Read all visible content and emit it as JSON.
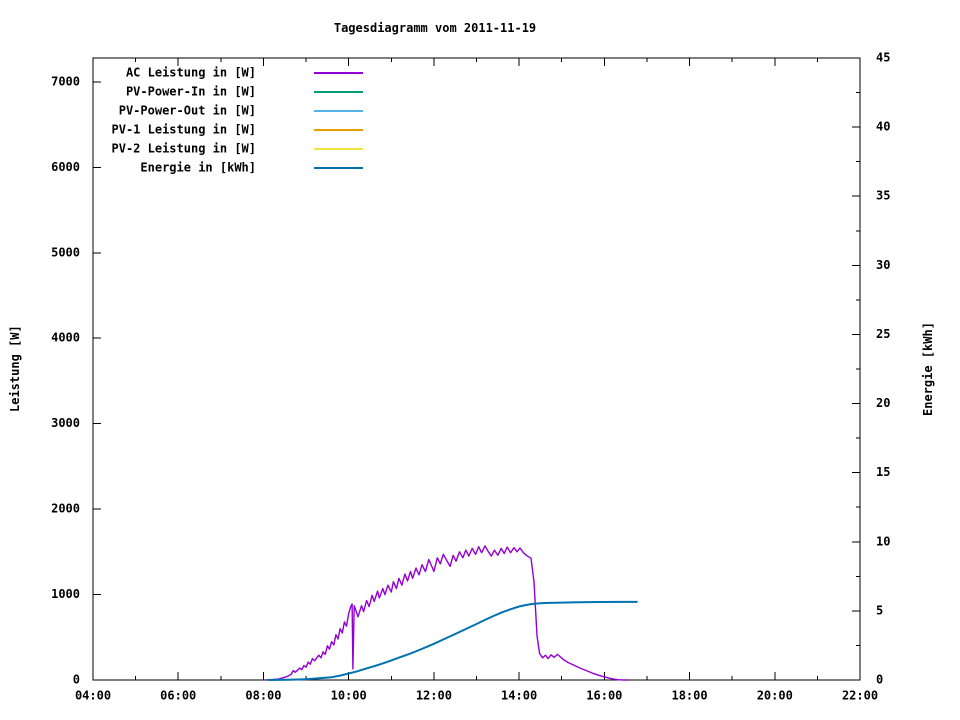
{
  "chart_data": {
    "type": "line",
    "title": "Tagesdiagramm vom 2011-11-19",
    "x_axis": {
      "unit": "time of day",
      "range": [
        4,
        22
      ],
      "ticks_major": [
        4,
        6,
        8,
        10,
        12,
        14,
        16,
        18,
        20,
        22
      ],
      "tick_labels": [
        "04:00",
        "06:00",
        "08:00",
        "10:00",
        "12:00",
        "14:00",
        "16:00",
        "18:00",
        "20:00",
        "22:00"
      ],
      "ticks_minor": [
        5,
        7,
        9,
        11,
        13,
        15,
        17,
        19,
        21
      ]
    },
    "y1_axis": {
      "label": "Leistung [W]",
      "range": [
        0,
        7280
      ],
      "ticks": [
        0,
        1000,
        2000,
        3000,
        4000,
        5000,
        6000,
        7000
      ],
      "tick_labels": [
        "0",
        "1000",
        "2000",
        "3000",
        "4000",
        "5000",
        "6000",
        "7000"
      ]
    },
    "y2_axis": {
      "label": "Energie [kWh]",
      "range": [
        0,
        45
      ],
      "ticks": [
        0,
        5,
        10,
        15,
        20,
        25,
        30,
        35,
        40,
        45
      ],
      "tick_labels": [
        "0",
        "5",
        "10",
        "15",
        "20",
        "25",
        "30",
        "35",
        "40",
        "45"
      ],
      "ticks_minor": [
        2.5,
        7.5,
        12.5,
        17.5,
        22.5,
        27.5,
        32.5,
        37.5,
        42.5
      ]
    },
    "legend_position": "top-left-inside",
    "grid": false,
    "series": [
      {
        "name": "AC Leistung in [W]",
        "color": "#9400D3",
        "axis": "y1",
        "unit": "W",
        "points": [
          [
            8.05,
            0
          ],
          [
            8.2,
            5
          ],
          [
            8.35,
            10
          ],
          [
            8.45,
            25
          ],
          [
            8.55,
            40
          ],
          [
            8.65,
            65
          ],
          [
            8.7,
            110
          ],
          [
            8.75,
            90
          ],
          [
            8.85,
            140
          ],
          [
            8.9,
            120
          ],
          [
            8.95,
            170
          ],
          [
            9.0,
            150
          ],
          [
            9.05,
            210
          ],
          [
            9.1,
            185
          ],
          [
            9.15,
            250
          ],
          [
            9.2,
            225
          ],
          [
            9.3,
            290
          ],
          [
            9.35,
            260
          ],
          [
            9.4,
            330
          ],
          [
            9.45,
            300
          ],
          [
            9.5,
            400
          ],
          [
            9.55,
            360
          ],
          [
            9.6,
            450
          ],
          [
            9.65,
            410
          ],
          [
            9.7,
            530
          ],
          [
            9.75,
            480
          ],
          [
            9.8,
            600
          ],
          [
            9.85,
            550
          ],
          [
            9.9,
            680
          ],
          [
            9.95,
            630
          ],
          [
            10.0,
            780
          ],
          [
            10.05,
            860
          ],
          [
            10.08,
            890
          ],
          [
            10.1,
            130
          ],
          [
            10.13,
            870
          ],
          [
            10.18,
            800
          ],
          [
            10.22,
            740
          ],
          [
            10.3,
            870
          ],
          [
            10.35,
            800
          ],
          [
            10.42,
            930
          ],
          [
            10.48,
            860
          ],
          [
            10.55,
            990
          ],
          [
            10.6,
            920
          ],
          [
            10.68,
            1040
          ],
          [
            10.72,
            960
          ],
          [
            10.8,
            1070
          ],
          [
            10.85,
            1000
          ],
          [
            10.92,
            1110
          ],
          [
            11.0,
            1030
          ],
          [
            11.05,
            1150
          ],
          [
            11.12,
            1070
          ],
          [
            11.18,
            1190
          ],
          [
            11.25,
            1110
          ],
          [
            11.32,
            1240
          ],
          [
            11.38,
            1160
          ],
          [
            11.45,
            1270
          ],
          [
            11.5,
            1190
          ],
          [
            11.58,
            1310
          ],
          [
            11.65,
            1230
          ],
          [
            11.72,
            1350
          ],
          [
            11.8,
            1270
          ],
          [
            11.88,
            1410
          ],
          [
            11.95,
            1330
          ],
          [
            12.0,
            1270
          ],
          [
            12.08,
            1430
          ],
          [
            12.15,
            1360
          ],
          [
            12.22,
            1470
          ],
          [
            12.3,
            1400
          ],
          [
            12.38,
            1330
          ],
          [
            12.45,
            1460
          ],
          [
            12.52,
            1390
          ],
          [
            12.6,
            1500
          ],
          [
            12.68,
            1430
          ],
          [
            12.75,
            1520
          ],
          [
            12.82,
            1450
          ],
          [
            12.9,
            1540
          ],
          [
            12.98,
            1470
          ],
          [
            13.05,
            1560
          ],
          [
            13.12,
            1490
          ],
          [
            13.2,
            1570
          ],
          [
            13.28,
            1500
          ],
          [
            13.35,
            1450
          ],
          [
            13.42,
            1520
          ],
          [
            13.5,
            1460
          ],
          [
            13.58,
            1540
          ],
          [
            13.65,
            1480
          ],
          [
            13.72,
            1555
          ],
          [
            13.8,
            1490
          ],
          [
            13.88,
            1550
          ],
          [
            13.95,
            1500
          ],
          [
            14.02,
            1545
          ],
          [
            14.1,
            1490
          ],
          [
            14.18,
            1455
          ],
          [
            14.28,
            1425
          ],
          [
            14.35,
            1150
          ],
          [
            14.42,
            520
          ],
          [
            14.48,
            310
          ],
          [
            14.55,
            260
          ],
          [
            14.62,
            290
          ],
          [
            14.68,
            250
          ],
          [
            14.75,
            295
          ],
          [
            14.82,
            265
          ],
          [
            14.9,
            300
          ],
          [
            14.98,
            265
          ],
          [
            15.05,
            235
          ],
          [
            15.15,
            205
          ],
          [
            15.3,
            170
          ],
          [
            15.45,
            135
          ],
          [
            15.6,
            105
          ],
          [
            15.75,
            75
          ],
          [
            15.9,
            50
          ],
          [
            16.05,
            30
          ],
          [
            16.2,
            12
          ],
          [
            16.32,
            3
          ],
          [
            16.45,
            0
          ],
          [
            16.55,
            0
          ]
        ]
      },
      {
        "name": "PV-Power-In in [W]",
        "color": "#009E73",
        "axis": "y1",
        "unit": "W",
        "points": []
      },
      {
        "name": "PV-Power-Out in [W]",
        "color": "#56B4E9",
        "axis": "y1",
        "unit": "W",
        "points": []
      },
      {
        "name": "PV-1 Leistung in [W]",
        "color": "#E69F00",
        "axis": "y1",
        "unit": "W",
        "points": []
      },
      {
        "name": "PV-2 Leistung in [W]",
        "color": "#F0E442",
        "axis": "y1",
        "unit": "W",
        "points": []
      },
      {
        "name": "Energie in [kWh]",
        "color": "#0072B2",
        "axis": "y2",
        "unit": "kWh",
        "points": [
          [
            8.1,
            0
          ],
          [
            8.6,
            0.02
          ],
          [
            9.0,
            0.06
          ],
          [
            9.3,
            0.12
          ],
          [
            9.6,
            0.2
          ],
          [
            9.8,
            0.32
          ],
          [
            10.0,
            0.47
          ],
          [
            10.2,
            0.63
          ],
          [
            10.4,
            0.82
          ],
          [
            10.6,
            1.0
          ],
          [
            10.8,
            1.2
          ],
          [
            11.0,
            1.42
          ],
          [
            11.2,
            1.64
          ],
          [
            11.4,
            1.86
          ],
          [
            11.6,
            2.1
          ],
          [
            11.8,
            2.36
          ],
          [
            12.0,
            2.62
          ],
          [
            12.2,
            2.9
          ],
          [
            12.4,
            3.18
          ],
          [
            12.6,
            3.47
          ],
          [
            12.8,
            3.76
          ],
          [
            13.0,
            4.05
          ],
          [
            13.2,
            4.35
          ],
          [
            13.4,
            4.63
          ],
          [
            13.6,
            4.9
          ],
          [
            13.8,
            5.12
          ],
          [
            14.0,
            5.32
          ],
          [
            14.15,
            5.42
          ],
          [
            14.3,
            5.5
          ],
          [
            14.5,
            5.55
          ],
          [
            14.7,
            5.58
          ],
          [
            15.0,
            5.6
          ],
          [
            15.4,
            5.62
          ],
          [
            15.9,
            5.64
          ],
          [
            16.4,
            5.65
          ],
          [
            16.78,
            5.65
          ]
        ]
      }
    ],
    "annotations": "AC power rises from ~08:00, jagged climb to a plateau of ~1400-1570 W between 12:30 and 14:15, sharp drop at ~14:25 to ~300 W, tapering to 0 by ~16:25. Cumulative energy S-curve flattens at ~5.65 kWh after ~14:45, line ends ~16:47."
  }
}
